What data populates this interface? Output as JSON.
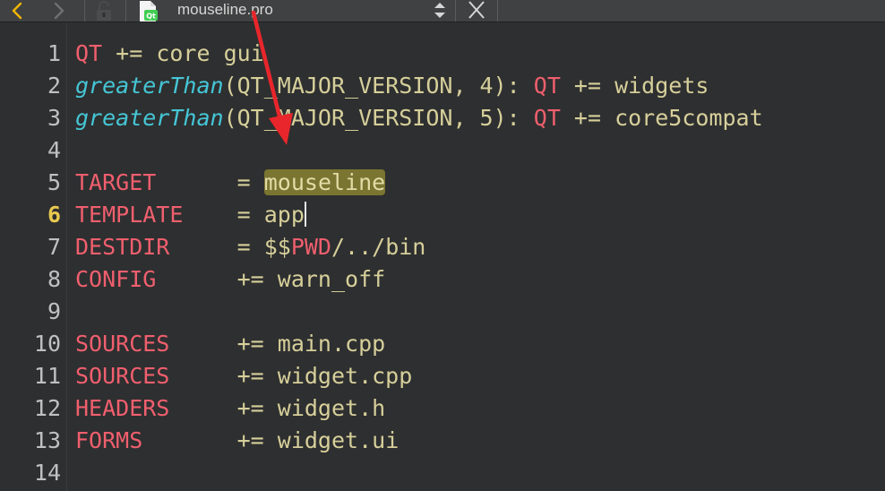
{
  "toolbar": {
    "back_icon": "chevron-left-icon",
    "forward_icon": "chevron-right-icon",
    "lock_icon": "lock-icon",
    "file_icon": "qt-file-icon",
    "file_icon_label": "Qt",
    "file_name": "mouseline.pro",
    "combo_icon": "up-down-arrows-icon",
    "close_icon": "close-icon"
  },
  "editor": {
    "current_line": "6",
    "lines": [
      {
        "num": "1",
        "segments": [
          {
            "t": "QT",
            "c": "kw"
          },
          {
            "t": " += core gui",
            "c": "txt"
          }
        ]
      },
      {
        "num": "2",
        "segments": [
          {
            "t": "greaterThan",
            "c": "fn"
          },
          {
            "t": "(QT_MAJOR_VERSION, 4): ",
            "c": "txt"
          },
          {
            "t": "QT",
            "c": "kw"
          },
          {
            "t": " += widgets",
            "c": "txt"
          }
        ]
      },
      {
        "num": "3",
        "segments": [
          {
            "t": "greaterThan",
            "c": "fn"
          },
          {
            "t": "(QT_MAJOR_VERSION, 5): ",
            "c": "txt"
          },
          {
            "t": "QT",
            "c": "kw"
          },
          {
            "t": " += core5compat",
            "c": "txt"
          }
        ]
      },
      {
        "num": "4",
        "segments": []
      },
      {
        "num": "5",
        "segments": [
          {
            "t": "TARGET",
            "c": "kw"
          },
          {
            "t": "      = ",
            "c": "txt"
          },
          {
            "t": "mouseline",
            "c": "hl"
          }
        ]
      },
      {
        "num": "6",
        "segments": [
          {
            "t": "TEMPLATE",
            "c": "kw"
          },
          {
            "t": "    = app",
            "c": "txt"
          },
          {
            "t": "",
            "c": "cursor"
          }
        ]
      },
      {
        "num": "7",
        "segments": [
          {
            "t": "DESTDIR",
            "c": "kw"
          },
          {
            "t": "     = $$",
            "c": "txt"
          },
          {
            "t": "PWD",
            "c": "kw"
          },
          {
            "t": "/../bin",
            "c": "txt"
          }
        ]
      },
      {
        "num": "8",
        "segments": [
          {
            "t": "CONFIG",
            "c": "kw"
          },
          {
            "t": "      += warn_off",
            "c": "txt"
          }
        ]
      },
      {
        "num": "9",
        "segments": []
      },
      {
        "num": "10",
        "segments": [
          {
            "t": "SOURCES",
            "c": "kw"
          },
          {
            "t": "     += main.cpp",
            "c": "txt"
          }
        ]
      },
      {
        "num": "11",
        "segments": [
          {
            "t": "SOURCES",
            "c": "kw"
          },
          {
            "t": "     += widget.cpp",
            "c": "txt"
          }
        ]
      },
      {
        "num": "12",
        "segments": [
          {
            "t": "HEADERS",
            "c": "kw"
          },
          {
            "t": "     += widget.h",
            "c": "txt"
          }
        ]
      },
      {
        "num": "13",
        "segments": [
          {
            "t": "FORMS",
            "c": "kw"
          },
          {
            "t": "       += widget.ui",
            "c": "txt"
          }
        ]
      },
      {
        "num": "14",
        "segments": []
      }
    ]
  },
  "colors": {
    "background": "#2e2f30",
    "keyword": "#f05f6e",
    "function": "#45c6d6",
    "text": "#d6cf9a",
    "highlight": "#7a7531",
    "current_line_number": "#e8c94f",
    "annotation_arrow": "#e8262b"
  },
  "annotation": {
    "icon": "red-arrow-icon"
  }
}
